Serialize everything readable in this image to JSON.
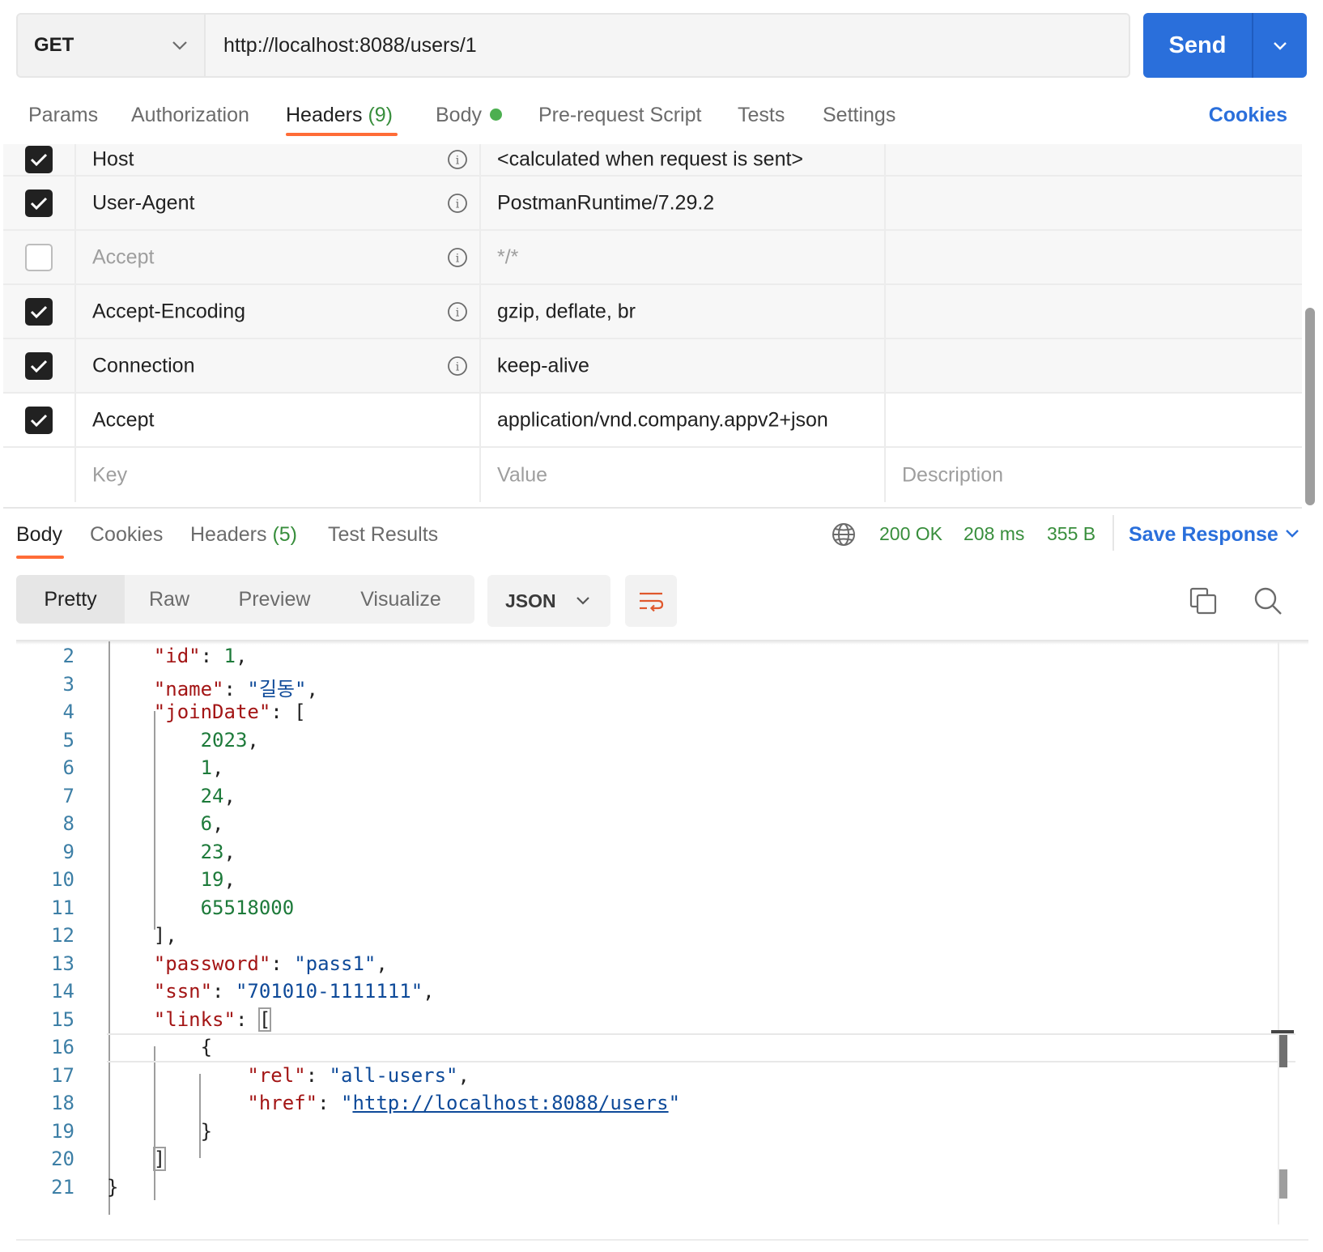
{
  "request": {
    "method": "GET",
    "url": "http://localhost:8088/users/1",
    "send_label": "Send"
  },
  "request_tabs": {
    "params": "Params",
    "authorization": "Authorization",
    "headers": "Headers",
    "headers_count": "(9)",
    "body": "Body",
    "pre_request": "Pre-request Script",
    "tests": "Tests",
    "settings": "Settings",
    "cookies": "Cookies"
  },
  "headers_table": {
    "rows": [
      {
        "key": "Host",
        "value": "<calculated when request is sent>",
        "checked": true
      },
      {
        "key": "User-Agent",
        "value": "PostmanRuntime/7.29.2",
        "checked": true
      },
      {
        "key": "Accept",
        "value": "*/*",
        "checked": false
      },
      {
        "key": "Accept-Encoding",
        "value": "gzip, deflate, br",
        "checked": true
      },
      {
        "key": "Connection",
        "value": "keep-alive",
        "checked": true
      },
      {
        "key": "Accept",
        "value": "application/vnd.company.appv2+json",
        "checked": true
      }
    ],
    "placeholders": {
      "key": "Key",
      "value": "Value",
      "description": "Description"
    }
  },
  "response_tabs": {
    "body": "Body",
    "cookies": "Cookies",
    "headers": "Headers",
    "headers_count": "(5)",
    "test_results": "Test Results"
  },
  "response_meta": {
    "status": "200 OK",
    "time": "208 ms",
    "size": "355 B",
    "save_response": "Save Response"
  },
  "view_modes": {
    "pretty": "Pretty",
    "raw": "Raw",
    "preview": "Preview",
    "visualize": "Visualize",
    "format": "JSON"
  },
  "code": {
    "line_numbers": [
      "2",
      "3",
      "4",
      "5",
      "6",
      "7",
      "8",
      "9",
      "10",
      "11",
      "12",
      "13",
      "14",
      "15",
      "16",
      "17",
      "18",
      "19",
      "20",
      "21"
    ],
    "id_key": "\"id\"",
    "id_val": "1",
    "name_key": "\"name\"",
    "name_val": "\"길동\"",
    "join_key": "\"joinDate\"",
    "join_vals": [
      "2023",
      "1",
      "24",
      "6",
      "23",
      "19",
      "65518000"
    ],
    "password_key": "\"password\"",
    "password_val": "\"pass1\"",
    "ssn_key": "\"ssn\"",
    "ssn_val": "\"701010-1111111\"",
    "links_key": "\"links\"",
    "rel_key": "\"rel\"",
    "rel_val": "\"all-users\"",
    "href_key": "\"href\"",
    "href_val": "http://localhost:8088/users"
  },
  "colors": {
    "accent": "#2a6fdb",
    "tab_underline": "#ff6c37",
    "success": "#388e3c",
    "json_key": "#a31515",
    "json_string": "#0e4a99",
    "json_number": "#1d7a3a"
  }
}
